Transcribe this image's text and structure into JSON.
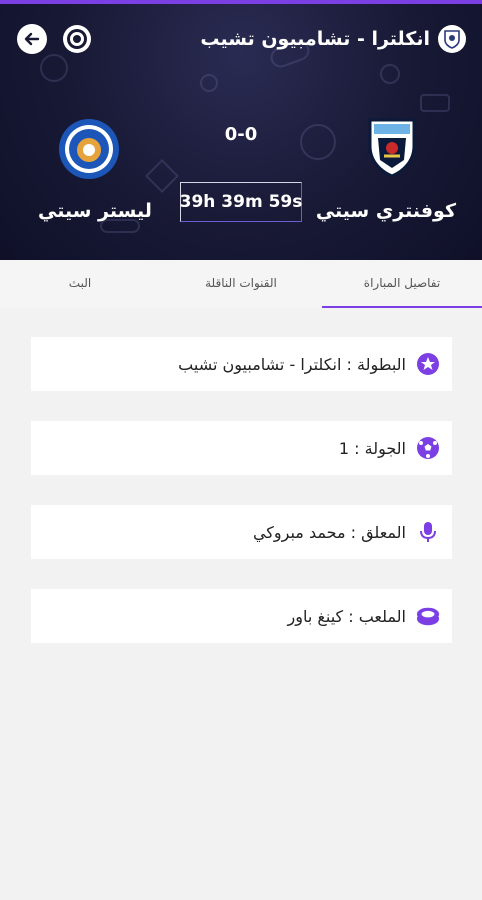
{
  "header": {
    "league_title": "انكلترا - تشامبيون تشيب",
    "score": "0-0",
    "countdown": "39h 39m 59s",
    "home_team": "كوفنتري سيتي",
    "away_team": "ليستر سيتي",
    "colors": {
      "accent": "#7b3fe4",
      "background": "#181935"
    }
  },
  "tabs": [
    {
      "label": "تفاصيل المباراة",
      "active": true
    },
    {
      "label": "القنوات الناقلة",
      "active": false
    },
    {
      "label": "البث",
      "active": false
    }
  ],
  "details": [
    {
      "icon": "soccer-ball-star-icon",
      "text": "البطولة : انكلترا - تشامبيون تشيب"
    },
    {
      "icon": "soccer-ball-icon",
      "text": "الجولة : 1"
    },
    {
      "icon": "microphone-icon",
      "text": "المعلق : محمد مبروكي"
    },
    {
      "icon": "stadium-icon",
      "text": "الملعب : كينغ باور"
    }
  ]
}
